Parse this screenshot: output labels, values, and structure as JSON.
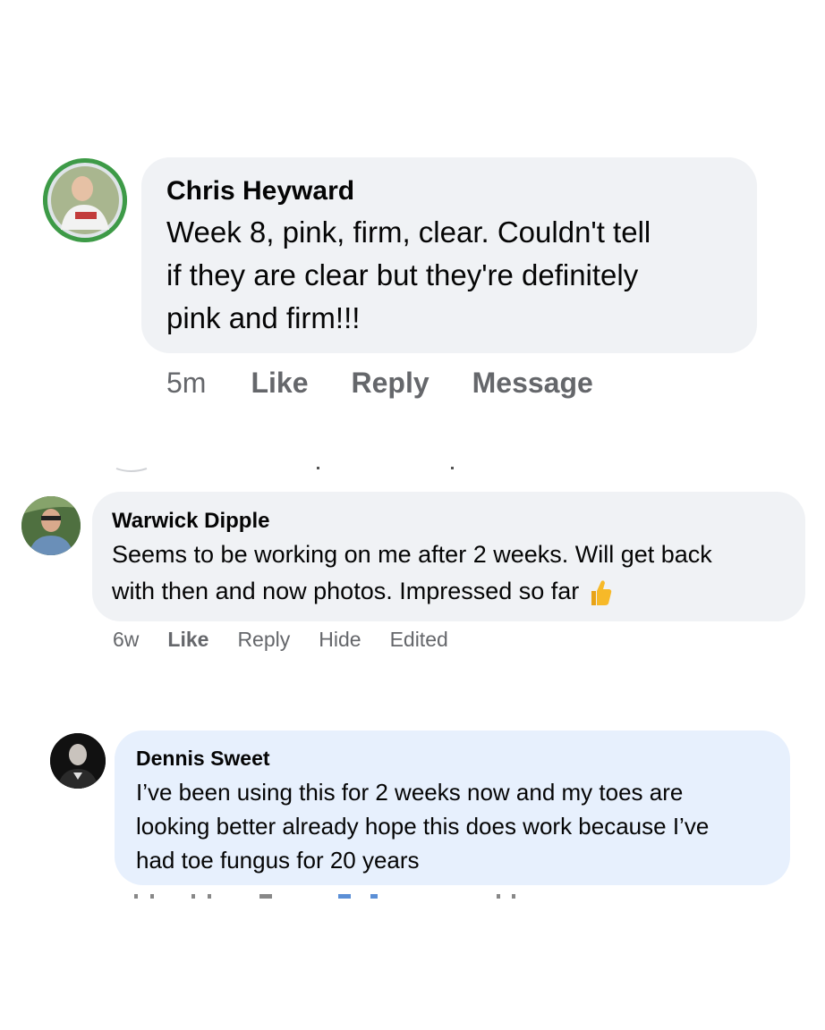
{
  "comments": [
    {
      "author": "Chris Heyward",
      "text_lines": [
        "Week 8, pink, firm, clear. Couldn't tell",
        "if they are clear but they're definitely",
        "pink and firm!!!"
      ],
      "time": "5m",
      "actions": [
        "Like",
        "Reply",
        "Message"
      ],
      "avatar_icon": "user-photo-avatar"
    },
    {
      "author": "Warwick Dipple",
      "text_lines": [
        "Seems to be working on me after 2 weeks. Will get back",
        "with then and now photos. Impressed so far"
      ],
      "emoji_icon": "thumbs-up-icon",
      "time": "6w",
      "like_label": "Like",
      "actions": [
        "Reply",
        "Hide",
        "Edited"
      ],
      "avatar_icon": "user-photo-avatar"
    },
    {
      "author": "Dennis Sweet",
      "text_lines": [
        "I’ve been using this for 2 weeks now and my toes are",
        "looking better already hope this does work because I’ve",
        "had toe fungus for 20 years"
      ],
      "avatar_icon": "user-photo-avatar"
    }
  ],
  "colors": {
    "bubble_gray": "#f0f2f5",
    "bubble_blue": "#e7f0fd",
    "meta_text": "#65676b",
    "thumb_yellow": "#f7b928"
  }
}
